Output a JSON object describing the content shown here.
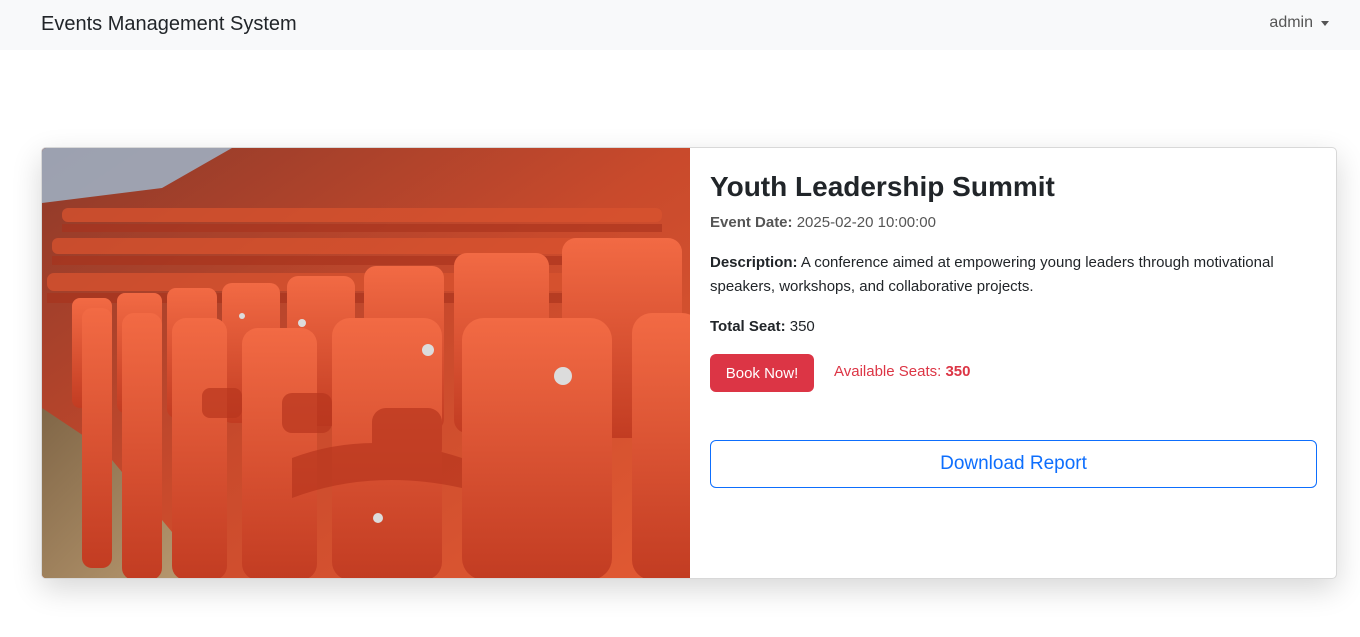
{
  "navbar": {
    "brand": "Events Management System",
    "user": "admin"
  },
  "event": {
    "title": "Youth Leadership Summit",
    "date_label": "Event Date:",
    "date_value": "2025-02-20 10:00:00",
    "description_label": "Description:",
    "description_value": "A conference aimed at empowering young leaders through motivational speakers, workshops, and collaborative projects.",
    "total_seat_label": "Total Seat:",
    "total_seat_value": "350",
    "book_button": "Book Now!",
    "available_label": "Available Seats:",
    "available_value": "350",
    "download_button": "Download Report"
  },
  "colors": {
    "navbar_bg": "#f8f9fa",
    "danger": "#dc3545",
    "primary": "#0d6efd",
    "seat_orange": "#e5542f"
  },
  "icons": {
    "dropdown": "caret-down-icon"
  }
}
